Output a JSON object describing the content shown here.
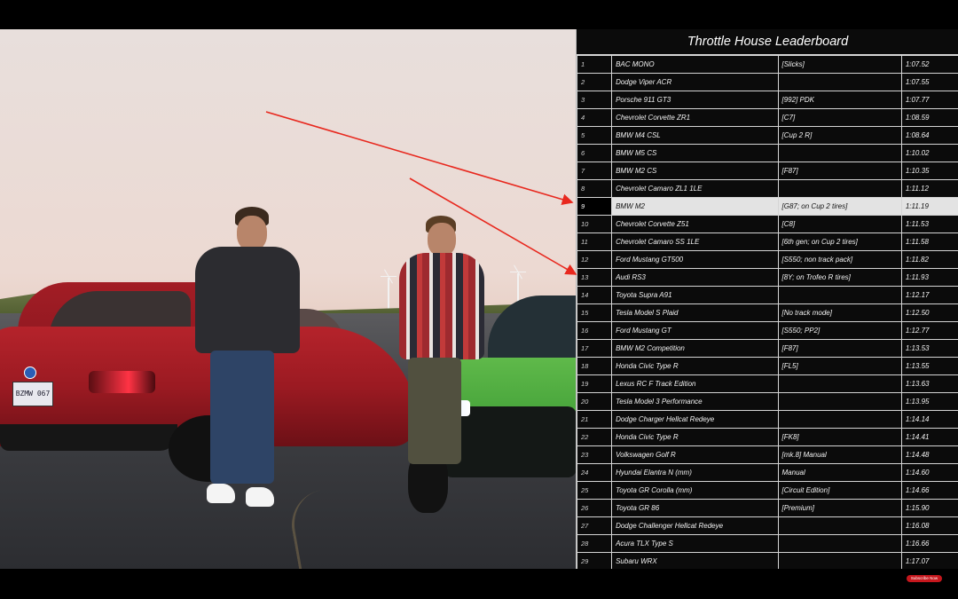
{
  "leaderboard": {
    "title": "Throttle House Leaderboard",
    "highlight_rank": 9,
    "rows": [
      {
        "rank": "1",
        "car": "BAC MONO",
        "note": "[Slicks]",
        "time": "1:07.52"
      },
      {
        "rank": "2",
        "car": "Dodge Viper ACR",
        "note": "",
        "time": "1:07.55"
      },
      {
        "rank": "3",
        "car": "Porsche 911 GT3",
        "note": "[992] PDK",
        "time": "1:07.77"
      },
      {
        "rank": "4",
        "car": "Chevrolet Corvette ZR1",
        "note": "[C7]",
        "time": "1:08.59"
      },
      {
        "rank": "5",
        "car": "BMW M4 CSL",
        "note": "[Cup 2 R]",
        "time": "1:08.64"
      },
      {
        "rank": "6",
        "car": "BMW M5 CS",
        "note": "",
        "time": "1:10.02"
      },
      {
        "rank": "7",
        "car": "BMW M2 CS",
        "note": "[F87]",
        "time": "1:10.35"
      },
      {
        "rank": "8",
        "car": "Chevrolet Camaro ZL1 1LE",
        "note": "",
        "time": "1:11.12"
      },
      {
        "rank": "9",
        "car": "BMW M2",
        "note": "[G87; on Cup 2 tires]",
        "time": "1:11.19"
      },
      {
        "rank": "10",
        "car": "Chevrolet Corvette Z51",
        "note": "[C8]",
        "time": "1:11.53"
      },
      {
        "rank": "11",
        "car": "Chevrolet Camaro SS 1LE",
        "note": "[6th gen; on Cup 2 tires]",
        "time": "1:11.58"
      },
      {
        "rank": "12",
        "car": "Ford Mustang GT500",
        "note": "[S550; non track pack]",
        "time": "1:11.82"
      },
      {
        "rank": "13",
        "car": "Audi RS3",
        "note": "[8Y; on Trofeo R tires]",
        "time": "1:11.93"
      },
      {
        "rank": "14",
        "car": "Toyota Supra A91",
        "note": "",
        "time": "1:12.17"
      },
      {
        "rank": "15",
        "car": "Tesla Model S Plaid",
        "note": "[No track mode]",
        "time": "1:12.50"
      },
      {
        "rank": "16",
        "car": "Ford Mustang GT",
        "note": "[S550; PP2]",
        "time": "1:12.77"
      },
      {
        "rank": "17",
        "car": "BMW M2 Competition",
        "note": "[F87]",
        "time": "1:13.53"
      },
      {
        "rank": "18",
        "car": "Honda Civic Type R",
        "note": "[FL5]",
        "time": "1:13.55"
      },
      {
        "rank": "19",
        "car": "Lexus RC F Track Edition",
        "note": "",
        "time": "1:13.63"
      },
      {
        "rank": "20",
        "car": "Tesla Model 3 Performance",
        "note": "",
        "time": "1:13.95"
      },
      {
        "rank": "21",
        "car": "Dodge Charger Hellcat Redeye",
        "note": "",
        "time": "1:14.14"
      },
      {
        "rank": "22",
        "car": "Honda Civic Type R",
        "note": "[FK8]",
        "time": "1:14.41"
      },
      {
        "rank": "23",
        "car": "Volkswagen Golf R",
        "note": "[mk.8] Manual",
        "time": "1:14.48"
      },
      {
        "rank": "24",
        "car": "Hyundai Elantra N     (mm)",
        "note": "Manual",
        "time": "1:14.60"
      },
      {
        "rank": "25",
        "car": "Toyota GR Corolla     (mm)",
        "note": "[Circuit Edition]",
        "time": "1:14.66"
      },
      {
        "rank": "26",
        "car": "Toyota GR 86",
        "note": "[Premium]",
        "time": "1:15.90"
      },
      {
        "rank": "27",
        "car": "Dodge Challenger Hellcat Redeye",
        "note": "",
        "time": "1:16.08"
      },
      {
        "rank": "28",
        "car": "Acura TLX Type S",
        "note": "",
        "time": "1:16.66"
      },
      {
        "rank": "29",
        "car": "Subaru WRX",
        "note": "",
        "time": "1:17.07"
      }
    ]
  },
  "scene": {
    "license_plate": "BZMW 067"
  },
  "overlay": {
    "subscribe_label": "Subscribe Now",
    "arrow_color": "#e8281e"
  },
  "colors": {
    "highlight_row": "#e3e3e3",
    "table_background": "#0b0b0b",
    "grid_lines": "#d5d5d5"
  }
}
